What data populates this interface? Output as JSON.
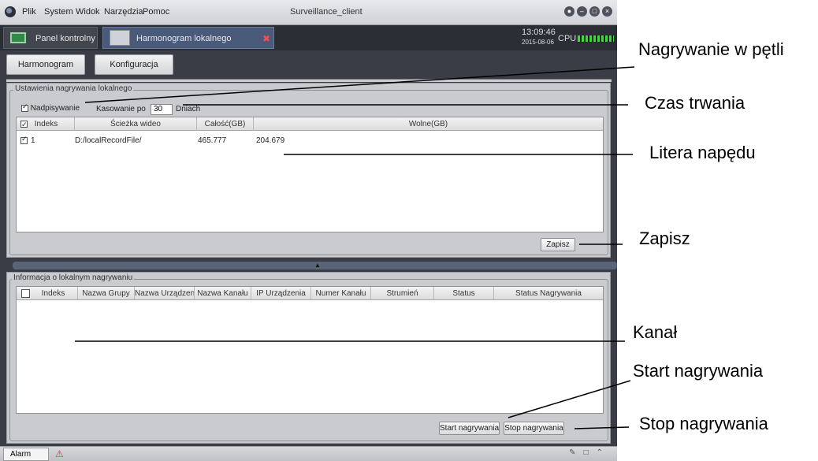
{
  "menubar": {
    "items": [
      "Plik",
      "System",
      "Widok",
      "Narzędzia",
      "Pomoc"
    ],
    "title": "Surveillance_client"
  },
  "tabs": [
    {
      "label": "Panel kontrolny",
      "icon": "monitor-icon"
    },
    {
      "label": "Harmonogram lokalnego nagrywania",
      "icon": "schedule-icon",
      "close": "✖"
    }
  ],
  "clock": {
    "time": "13:09:46",
    "date": "2015-08-06",
    "cpu_label": "CPU"
  },
  "toolbar": {
    "schedule": "Harmonogram",
    "config": "Konfiguracja"
  },
  "local_settings": {
    "legend": "Ustawienia nagrywania lokalnego",
    "overwrite_label": "Nadpisywanie",
    "overwrite_checked": true,
    "delete_after_label": "Kasowanie po",
    "delete_after_value": "30",
    "days_label": "Dniach",
    "columns": [
      "Indeks",
      "Ścieżka wideo",
      "Całość(GB)",
      "Wolne(GB)"
    ],
    "rows": [
      {
        "index": "1",
        "path": "D:/localRecordFile/",
        "total": "465.777",
        "free": "204.679",
        "checked": true
      }
    ],
    "save_button": "Zapisz"
  },
  "record_info": {
    "legend": "Informacja o lokalnym nagrywaniu",
    "columns": [
      "Indeks",
      "Nazwa Grupy",
      "Nazwa Urządzeni",
      "Nazwa Kanału",
      "IP Urządzenia",
      "Numer Kanału",
      "Strumień",
      "Status",
      "Status Nagrywania"
    ],
    "start_button": "Start nagrywania",
    "stop_button": "Stop nagrywania"
  },
  "statusbar": {
    "alarm": "Alarm"
  },
  "annotations": {
    "loop": "Nagrywanie w pętli",
    "duration": "Czas trwania",
    "drive": "Litera napędu",
    "save": "Zapisz",
    "channel": "Kanał",
    "start": "Start nagrywania",
    "stop": "Stop nagrywania"
  },
  "colors": {
    "accent_tab": "#4a5a7a",
    "cpu_bar": "#3cdc3c",
    "close": "#ff4b4b"
  }
}
